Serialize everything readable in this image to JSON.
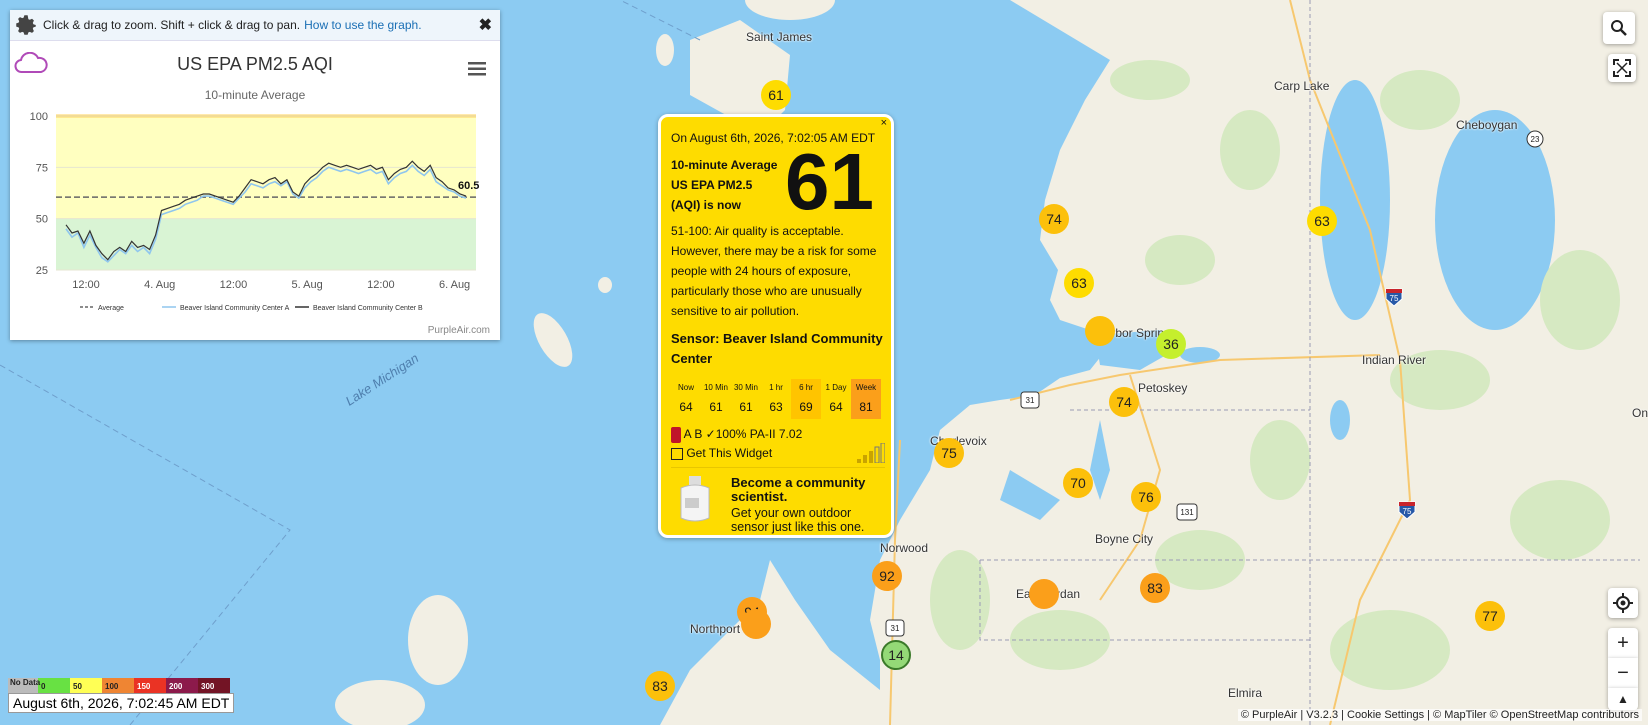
{
  "map": {
    "places": [
      "Saint James",
      "Carp Lake",
      "Cheboygan",
      "Harbor Springs",
      "Petoskey",
      "Indian River",
      "Charlevoix",
      "Norwood",
      "Boyne City",
      "East Jordan",
      "Northport",
      "Elmira",
      "On"
    ],
    "water": "Lake Michigan",
    "markers": [
      "61",
      "74",
      "63",
      "63",
      "74",
      "36",
      "74",
      "75",
      "70",
      "76",
      "92",
      "83",
      "94",
      "83",
      "77",
      "14"
    ],
    "shields": [
      "31",
      "131",
      "75",
      "23",
      "75",
      "31"
    ]
  },
  "colors": {
    "water": "#8ccbf2",
    "land": "#f2efe4",
    "yellow": "#fedc00",
    "orange": "#fb9f1a",
    "green": "#94d977"
  },
  "chart": {
    "bar_text": "Click & drag to zoom. Shift + click & drag to pan.",
    "bar_link": "How to use the graph.",
    "close": "✖",
    "title": "US EPA PM2.5 AQI",
    "subtitle": "10-minute Average",
    "credit": "PurpleAir.com"
  },
  "chart_data": {
    "type": "line",
    "title": "US EPA PM2.5 AQI",
    "subtitle": "10-minute Average",
    "ylim": [
      25,
      100
    ],
    "yticks": [
      25,
      50,
      75,
      100
    ],
    "xticks": [
      "12:00",
      "4. Aug",
      "12:00",
      "5. Aug",
      "12:00",
      "6. Aug"
    ],
    "average_value": 60.5,
    "last_label": "60.5",
    "series": [
      {
        "name": "Beaver Island Community Center A",
        "color": "#8fc6ee",
        "values": [
          45,
          41,
          43,
          36,
          42,
          36,
          31,
          29,
          32,
          35,
          33,
          37,
          34,
          36,
          33,
          40,
          52,
          53,
          54,
          55,
          57,
          58,
          59,
          61,
          61,
          60,
          59,
          58,
          57,
          60,
          63,
          67,
          66,
          65,
          67,
          68,
          66,
          68,
          62,
          60,
          65,
          68,
          70,
          73,
          75,
          74,
          73,
          74,
          73,
          72,
          73,
          74,
          72,
          73,
          67,
          70,
          72,
          73,
          76,
          73,
          71,
          74,
          68,
          66,
          64,
          63,
          61,
          60
        ]
      },
      {
        "name": "Beaver Island Community Center B",
        "color": "#333333",
        "values": [
          47,
          43,
          44,
          38,
          44,
          37,
          33,
          30,
          34,
          36,
          34,
          39,
          36,
          37,
          35,
          42,
          54,
          55,
          56,
          57,
          59,
          60,
          61,
          62,
          62,
          61,
          60,
          59,
          58,
          61,
          65,
          69,
          68,
          67,
          69,
          70,
          67,
          69,
          63,
          61,
          67,
          70,
          72,
          75,
          77,
          76,
          75,
          76,
          75,
          74,
          75,
          76,
          74,
          75,
          69,
          72,
          74,
          75,
          78,
          75,
          73,
          76,
          70,
          68,
          65,
          64,
          62,
          61
        ]
      }
    ],
    "legend": [
      "Average",
      "Beaver Island Community Center A",
      "Beaver Island Community Center B"
    ],
    "bands": [
      {
        "from": 50,
        "to": 100,
        "color": "#ffffc0"
      },
      {
        "from": 25,
        "to": 50,
        "color": "#d9f4d4"
      }
    ]
  },
  "popup": {
    "close": "×",
    "date": "On August 6th, 2026, 7:02:05 AM EDT",
    "avg_label": "10-minute Average US EPA PM2.5 (AQI) is now",
    "value": "61",
    "desc": "51-100: Air quality is acceptable. However, there may be a risk for some people with 24 hours of exposure, particularly those who are unusually sensitive to air pollution.",
    "sensor": "Sensor: Beaver Island Community Center",
    "table_heads": [
      "Now",
      "10 Min",
      "30 Min",
      "1 hr",
      "6 hr",
      "1 Day",
      "Week"
    ],
    "table_values": [
      "64",
      "61",
      "61",
      "63",
      "69",
      "64",
      "81"
    ],
    "meta": "A B ✓100% PA-II 7.02",
    "widget": "Get This Widget",
    "promo_title": "Become a community scientist.",
    "promo_desc": "Get your own outdoor sensor just like this one."
  },
  "legend": {
    "labels": [
      "No Data",
      "0",
      "50",
      "100",
      "150",
      "200",
      "300"
    ],
    "date": "August 6th, 2026, 7:02:45 AM EDT"
  },
  "attribution": "© PurpleAir | V3.2.3 | Cookie Settings | © MapTiler © OpenStreetMap contributors",
  "controls": {
    "zoom_in": "+",
    "zoom_out": "−",
    "reset": "▲"
  }
}
